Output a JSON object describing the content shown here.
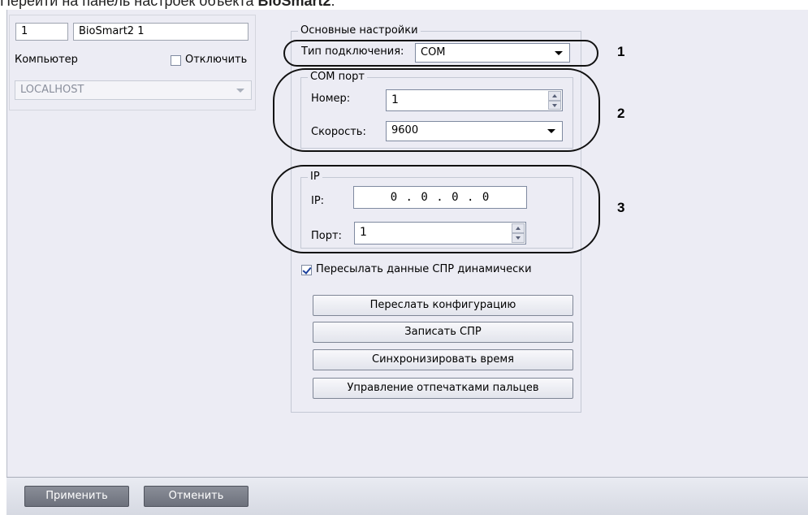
{
  "doc_header": {
    "text_prefix": "Перейти на панель настроек объекта ",
    "object_name": "BioSmart2",
    "suffix": "."
  },
  "object": {
    "id_value": "1",
    "name_value": "BioSmart2 1",
    "computer_label": "Компьютер",
    "disable_label": "Отключить",
    "disable_checked": false,
    "computer_value": "LOCALHOST"
  },
  "main_settings": {
    "title": "Основные настройки",
    "connection_type_label": "Тип подключения:",
    "connection_type_value": "COM",
    "com_port": {
      "title": "COM порт",
      "number_label": "Номер:",
      "number_value": "1",
      "speed_label": "Скорость:",
      "speed_value": "9600"
    },
    "ip": {
      "title": "IP",
      "ip_label": "IP:",
      "ip_value": "0 . 0 . 0 . 0",
      "port_label": "Порт:",
      "port_value": "1"
    },
    "dynamic_send_label": "Пересылать  данные СПР динамически",
    "dynamic_send_checked": true,
    "buttons": {
      "send_config": "Переслать конфигурацию",
      "write_spr": "Записать СПР",
      "sync_time": "Синхронизировать время",
      "fingerprints": "Управление отпечатками пальцев"
    }
  },
  "annotations": {
    "one": "1",
    "two": "2",
    "three": "3"
  },
  "footer": {
    "apply": "Применить",
    "cancel": "Отменить"
  }
}
